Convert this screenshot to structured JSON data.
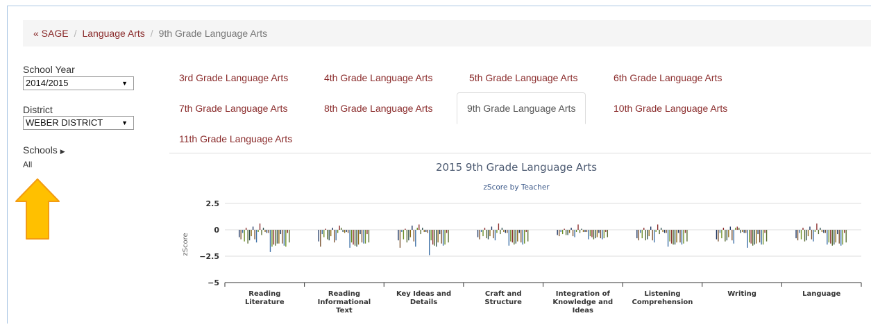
{
  "breadcrumb": {
    "home": "« SAGE",
    "sep": "/",
    "section": "Language Arts",
    "current": "9th Grade Language Arts"
  },
  "filters": {
    "school_year_label": "School Year",
    "school_year_value": "2014/2015",
    "district_label": "District",
    "district_value": "WEBER DISTRICT",
    "schools_label": "Schools",
    "schools_value": "All"
  },
  "tabs": [
    {
      "label": "3rd Grade Language Arts",
      "active": false
    },
    {
      "label": "4th Grade Language Arts",
      "active": false
    },
    {
      "label": "5th Grade Language Arts",
      "active": false
    },
    {
      "label": "6th Grade Language Arts",
      "active": false
    },
    {
      "label": "7th Grade Language Arts",
      "active": false
    },
    {
      "label": "8th Grade Language Arts",
      "active": false
    },
    {
      "label": "9th Grade Language Arts",
      "active": true
    },
    {
      "label": "10th Grade Language Arts",
      "active": false
    },
    {
      "label": "11th Grade Language Arts",
      "active": false
    }
  ],
  "colors": {
    "link": "#8a2b2b",
    "arrow_fill": "#ffc000",
    "arrow_stroke": "#f39c12",
    "chart_title": "#4d5b72",
    "chart_subtitle": "#3d5a8a"
  },
  "chart_data": {
    "type": "bar",
    "title": "2015 9th Grade Language Arts",
    "subtitle": "zScore by Teacher",
    "ylabel": "zScore",
    "ylim": [
      -5,
      2.5
    ],
    "yticks": [
      "2.5",
      "0",
      "−2.5",
      "−5"
    ],
    "ytick_values": [
      2.5,
      0,
      -2.5,
      -5
    ],
    "categories": [
      "Reading Literature",
      "Reading Informational Text",
      "Key Ideas and Details",
      "Craft and Structure",
      "Integration of Knowledge and Ideas",
      "Listening Comprehension",
      "Writing",
      "Language"
    ],
    "category_lines": [
      [
        "Reading",
        "Literature"
      ],
      [
        "Reading",
        "Informational",
        "Text"
      ],
      [
        "Key Ideas and",
        "Details"
      ],
      [
        "Craft and",
        "Structure"
      ],
      [
        "Integration of",
        "Knowledge and",
        "Ideas"
      ],
      [
        "Listening",
        "Comprehension"
      ],
      [
        "Writing"
      ],
      [
        "Language"
      ]
    ],
    "series_colors": [
      "#1f3763",
      "#7a5230",
      "#3b6ea5",
      "#6b8e23",
      "#8b2d2d",
      "#556b2f",
      "#2f4f4f",
      "#8b6914"
    ],
    "values": [
      [
        -0.7,
        -0.9,
        -0.3,
        -1.1,
        0.2,
        -1.3,
        -1.0,
        -0.6,
        0.3,
        -0.9,
        -1.2,
        -0.2,
        0.6,
        -0.5,
        0.2,
        -0.2,
        -0.3,
        -0.3,
        -2.1,
        -1.6,
        -1.4,
        -1.5,
        -1.3,
        -1.3,
        -0.4,
        -1.3,
        -1.5,
        -1.6,
        -0.3,
        -1.2
      ],
      [
        -1.1,
        -1.6,
        -0.4,
        -0.7,
        0.1,
        -0.9,
        -1.0,
        -0.6,
        0.2,
        -1.2,
        -1.0,
        -0.3,
        0.4,
        0.2,
        -0.2,
        -0.3,
        -0.2,
        -0.3,
        -1.7,
        -1.2,
        -1.4,
        -1.5,
        -1.6,
        -1.4,
        -0.4,
        -1.2,
        -1.3,
        -1.3,
        -0.4,
        -1.2
      ],
      [
        -1.0,
        -1.7,
        -0.2,
        -0.9,
        0.1,
        -1.2,
        -1.0,
        -0.7,
        0.4,
        -1.1,
        -1.6,
        0.2,
        0.5,
        -0.4,
        0.2,
        -0.2,
        -0.2,
        -0.3,
        -2.4,
        -1.0,
        -1.4,
        -1.5,
        -1.6,
        -1.2,
        -0.4,
        -1.3,
        -1.5,
        -1.4,
        -0.3,
        -1.2
      ],
      [
        -0.7,
        -0.9,
        -0.2,
        -0.6,
        0.2,
        -0.8,
        -0.9,
        -0.6,
        0.3,
        -0.8,
        -1.0,
        -0.3,
        0.6,
        -0.4,
        0.2,
        -0.2,
        -0.3,
        -0.3,
        -1.5,
        -1.1,
        -1.2,
        -1.4,
        -1.3,
        -1.1,
        -0.3,
        -1.2,
        -1.4,
        -1.3,
        -0.2,
        -1.1
      ],
      [
        -0.5,
        -0.6,
        -0.2,
        -0.4,
        0.1,
        -0.5,
        -0.5,
        -0.3,
        0.2,
        -0.6,
        -0.7,
        -0.2,
        0.5,
        -0.3,
        0.1,
        -0.2,
        -0.2,
        -0.2,
        -0.9,
        -0.6,
        -0.7,
        -0.9,
        -0.8,
        -0.7,
        -0.3,
        -0.8,
        -0.9,
        -0.8,
        -0.2,
        -0.7
      ],
      [
        -0.8,
        -1.0,
        -0.3,
        -0.8,
        0.2,
        -1.0,
        -0.9,
        -0.6,
        0.3,
        -1.0,
        -1.2,
        -0.2,
        0.5,
        -0.4,
        0.2,
        -0.2,
        -0.3,
        -0.3,
        -1.6,
        -1.1,
        -1.3,
        -1.4,
        -1.4,
        -1.2,
        -0.3,
        -1.2,
        -1.4,
        -1.3,
        -0.3,
        -1.1
      ],
      [
        -0.9,
        -1.1,
        -0.3,
        -0.8,
        0.2,
        -1.1,
        -1.0,
        -0.7,
        0.3,
        -1.0,
        -1.3,
        0.2,
        0.3,
        0.2,
        -0.3,
        -0.2,
        -0.3,
        -0.3,
        -1.7,
        -1.2,
        -1.3,
        -1.5,
        -1.4,
        -1.3,
        -0.4,
        -1.2,
        -1.4,
        -1.4,
        -0.3,
        -1.1
      ],
      [
        -0.8,
        -1.0,
        -0.3,
        -0.9,
        0.2,
        -1.1,
        -1.0,
        -0.6,
        0.3,
        -0.9,
        -1.1,
        -0.2,
        0.6,
        -0.4,
        0.2,
        -0.2,
        -0.3,
        -0.3,
        -1.4,
        -1.2,
        -1.3,
        -1.5,
        -1.4,
        -1.2,
        -0.4,
        -1.3,
        -1.5,
        -1.4,
        -0.3,
        -1.2
      ]
    ]
  }
}
